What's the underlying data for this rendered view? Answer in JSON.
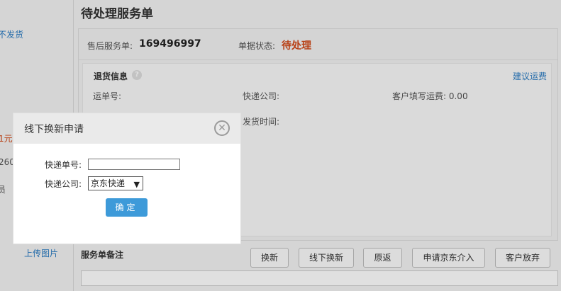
{
  "sidebar": {
    "ship_link": "不发货",
    "price_red": "1元",
    "number": "260",
    "staff": "员",
    "upload_link": "上传图片"
  },
  "page": {
    "title": "待处理服务单"
  },
  "service": {
    "order_label": "售后服务单:",
    "order_number": "169496997",
    "status_label": "单据状态:",
    "status_value": "待处理"
  },
  "return_info": {
    "title": "退货信息",
    "suggest_link": "建议运费",
    "waybill_label": "运单号:",
    "courier_label": "快递公司:",
    "freight_label": "客户填写运费: 0.00",
    "ship_time_label": "发货时间:"
  },
  "actions": {
    "exchange": "换新",
    "offline_exchange": "线下换新",
    "return_original": "原返",
    "request_jd": "申请京东介入",
    "customer_abandon": "客户放弃"
  },
  "remark": {
    "title": "服务单备注"
  },
  "modal": {
    "title": "线下换新申请",
    "close_glyph": "✕",
    "tracking_label": "快递单号:",
    "tracking_value": "",
    "courier_label": "快递公司:",
    "courier_selected": "京东快递",
    "caret_glyph": "▼",
    "confirm_label": "确定"
  },
  "icons": {
    "help_glyph": "?"
  },
  "colors": {
    "accent_blue": "#3d9ad9",
    "link_blue": "#2a7bc2",
    "status_red": "#d24a1a"
  }
}
